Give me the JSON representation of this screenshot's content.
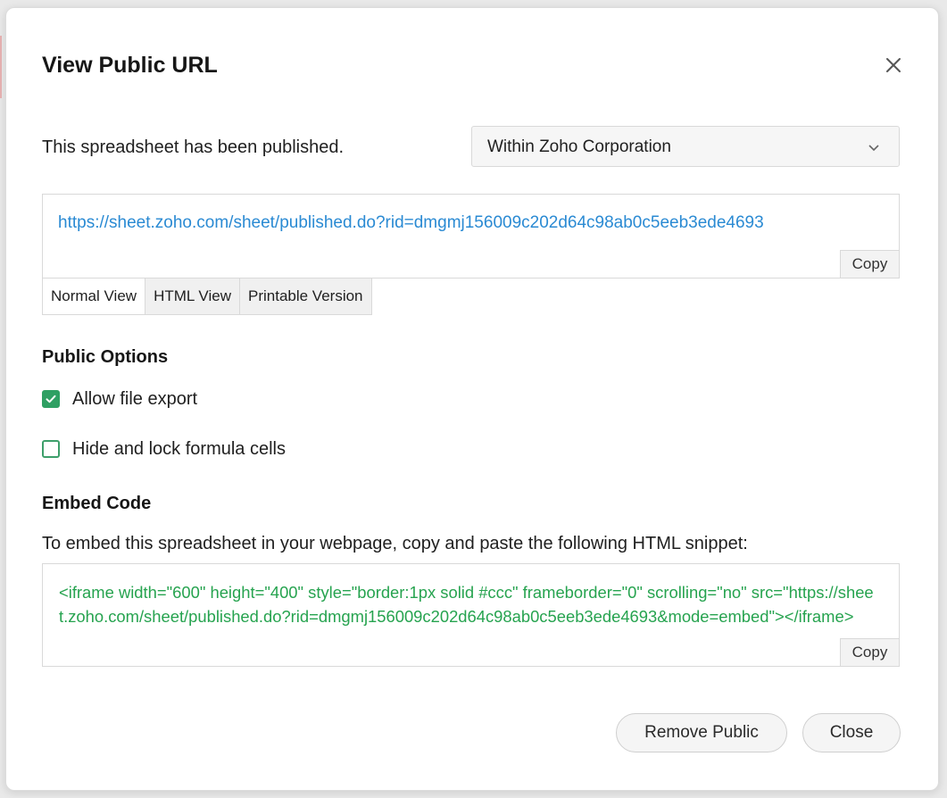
{
  "dialog": {
    "title": "View Public URL",
    "status_text": "This spreadsheet has been published.",
    "scope_select": {
      "selected": "Within Zoho Corporation"
    },
    "public_url": "https://sheet.zoho.com/sheet/published.do?rid=dmgmj156009c202d64c98ab0c5eeb3ede4693",
    "copy_label": "Copy",
    "view_tabs": [
      "Normal View",
      "HTML View",
      "Printable Version"
    ],
    "active_view_tab": "Normal View",
    "public_options": {
      "heading": "Public Options",
      "allow_file_export": {
        "label": "Allow file export",
        "checked": true
      },
      "hide_lock_formula": {
        "label": "Hide and lock formula cells",
        "checked": false
      }
    },
    "embed": {
      "heading": "Embed Code",
      "description": "To embed this spreadsheet in your webpage, copy and paste the following HTML snippet:",
      "code": "<iframe width=\"600\" height=\"400\" style=\"border:1px solid #ccc\" frameborder=\"0\" scrolling=\"no\" src=\"https://sheet.zoho.com/sheet/published.do?rid=dmgmj156009c202d64c98ab0c5eeb3ede4693&mode=embed\"></iframe>",
      "copy_label": "Copy"
    },
    "buttons": {
      "remove_public": "Remove Public",
      "close": "Close"
    }
  },
  "icons": {
    "close": "close-icon",
    "dropdown": "chevron-down-icon",
    "check": "checkmark-icon"
  },
  "colors": {
    "link": "#2a8ad3",
    "code": "#26a34f",
    "checkbox": "#2fa063"
  }
}
